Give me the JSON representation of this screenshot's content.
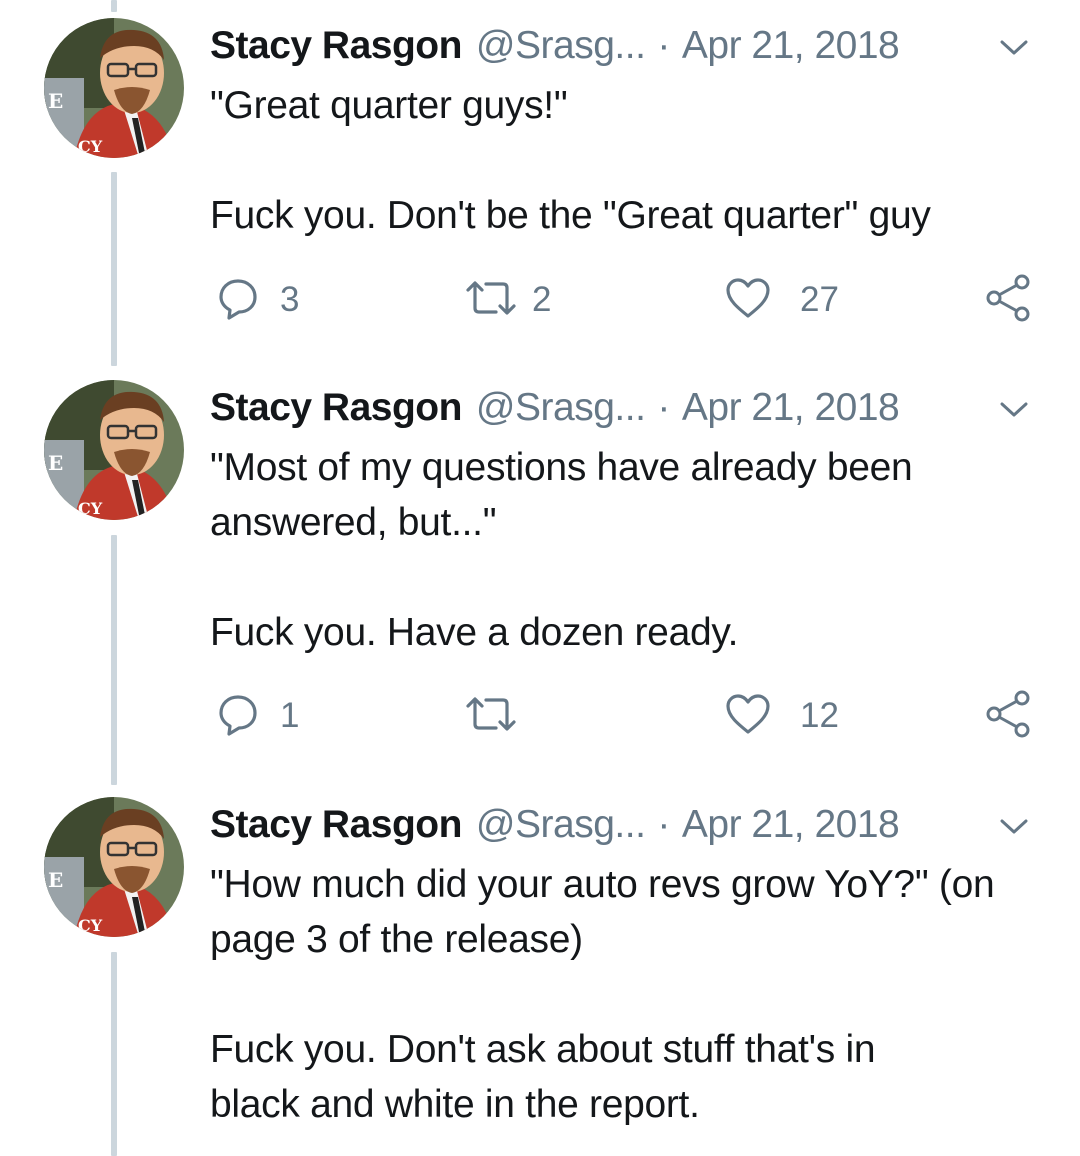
{
  "thread": {
    "tweets": [
      {
        "display_name": "Stacy Rasgon",
        "handle": "@Srasg...",
        "separator": "·",
        "date": "Apr 21, 2018",
        "paragraphs": [
          "\"Great quarter guys!\"",
          "Fuck you. Don't be the \"Great quarter\" guy"
        ],
        "reply_count": "3",
        "retweet_count": "2",
        "like_count": "27"
      },
      {
        "display_name": "Stacy Rasgon",
        "handle": "@Srasg...",
        "separator": "·",
        "date": "Apr 21, 2018",
        "paragraphs": [
          "\"Most of my questions have already been answered, but...\"",
          "Fuck you. Have a dozen ready."
        ],
        "reply_count": "1",
        "retweet_count": "",
        "like_count": "12"
      },
      {
        "display_name": "Stacy Rasgon",
        "handle": "@Srasg...",
        "separator": "·",
        "date": "Apr 21, 2018",
        "paragraphs": [
          "\"How much did your auto revs grow YoY?\" (on page 3 of the release)",
          "Fuck you. Don't ask about stuff that's in black and white in the report."
        ],
        "reply_count": "",
        "retweet_count": "",
        "like_count": ""
      }
    ]
  },
  "icons": {
    "reply": "reply-icon",
    "retweet": "retweet-icon",
    "like": "heart-icon",
    "share": "share-icon",
    "more": "chevron-down-icon"
  },
  "colors": {
    "text": "#14171a",
    "muted": "#657786",
    "thread_line": "#ccd6dd",
    "background": "#ffffff"
  }
}
